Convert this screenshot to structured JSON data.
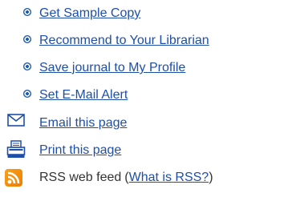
{
  "links": [
    {
      "label": "Get Sample Copy"
    },
    {
      "label": "Recommend to Your Librarian"
    },
    {
      "label": "Save journal to My Profile"
    },
    {
      "label": "Set E-Mail Alert"
    },
    {
      "label": "Email this page"
    },
    {
      "label": "Print this page"
    }
  ],
  "rss": {
    "label": "RSS web feed",
    "open_paren": "(",
    "what_is_label": "What is RSS?",
    "close_paren": ")"
  },
  "icons": {
    "bullet": "bullet-icon",
    "email": "envelope-icon",
    "print": "printer-icon",
    "rss": "rss-icon"
  },
  "colors": {
    "link": "#1e4fa8",
    "text": "#333333",
    "rss_orange": "#ef7d00",
    "bullet_blue": "#4f86c6"
  }
}
